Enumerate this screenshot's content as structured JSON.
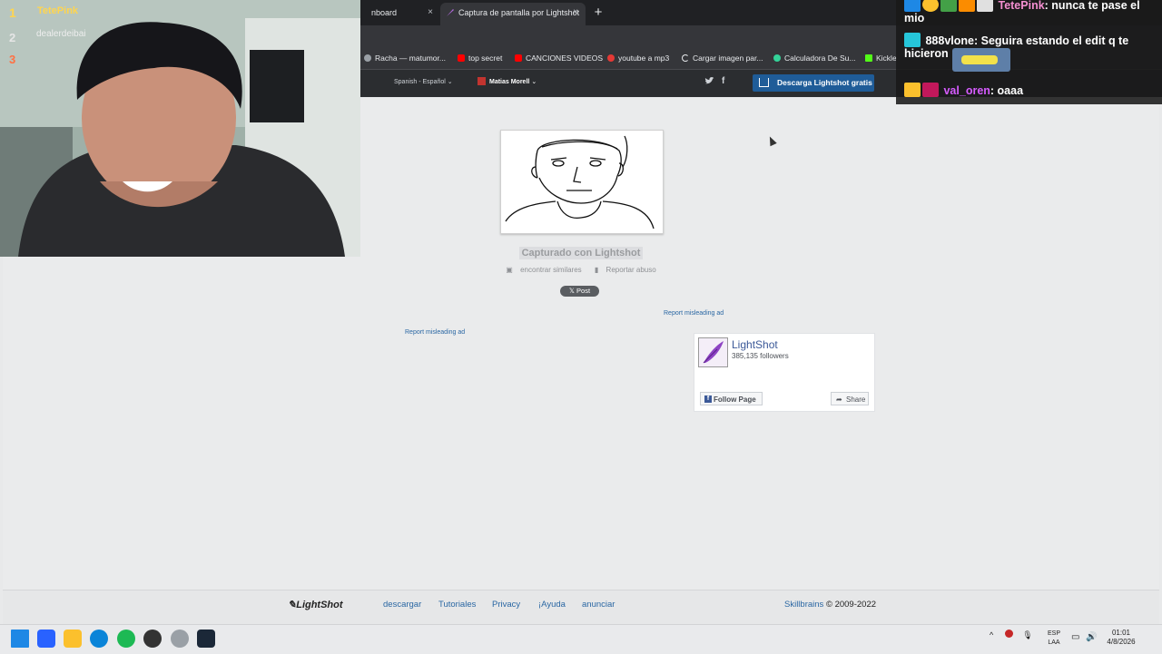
{
  "browser": {
    "tabs": [
      {
        "label": "nboard",
        "active": false
      },
      {
        "label": "Captura de pantalla por Lightshot",
        "active": true
      }
    ],
    "close_glyph": "×",
    "new_tab_glyph": "+",
    "bookmarks": [
      {
        "label": "Racha — matumor...",
        "icon": "globe-icon",
        "color": "#9aa0a6"
      },
      {
        "label": "top secret",
        "icon": "youtube-icon",
        "color": "#ff0000"
      },
      {
        "label": "CANCIONES VIDEOS",
        "icon": "youtube-icon",
        "color": "#ff0000"
      },
      {
        "label": "youtube a mp3",
        "icon": "youtube-icon",
        "color": "#e53935"
      },
      {
        "label": "Cargar imagen par...",
        "icon": "loader-icon",
        "color": "#e8eaed"
      },
      {
        "label": "Calculadora De Su...",
        "icon": "calculator-icon",
        "color": "#34d399"
      },
      {
        "label": "Kickle",
        "icon": "kick-icon",
        "color": "#53fc18"
      }
    ]
  },
  "lightshot": {
    "language": "Spanish - Español",
    "user": "Matias Morell",
    "twitter_glyph": "🐦",
    "facebook_glyph": "f",
    "download_button": "Descarga Lightshot gratis",
    "caption": "Capturado con Lightshot",
    "find_similar": "encontrar similares",
    "report_abuse": "Reportar abuso",
    "post_button": "𝕏 Post",
    "misleading_ad_1": "Report misleading ad",
    "misleading_ad_2": "Report misleading ad",
    "fb_page": {
      "name": "LightShot",
      "followers": "385,135 followers",
      "follow": "Follow Page",
      "share": "Share"
    }
  },
  "footer": {
    "logo": "LightShot",
    "links": [
      "descargar",
      "Tutoriales",
      "Privacy",
      "¡Ayuda",
      "anunciar"
    ],
    "company": "Skillbrains",
    "copyright": "© 2009-2022"
  },
  "leaderboard": [
    {
      "rank": "1",
      "name": "TetePink",
      "color": "#ffd54f"
    },
    {
      "rank": "2",
      "name": "dealerdeibai",
      "color": "#e6e6e6"
    },
    {
      "rank": "3",
      "name": "",
      "color": "#ff7043"
    }
  ],
  "chat": [
    {
      "user": "TetePink",
      "user_color": "#f48fd1",
      "message": ": nunca te pase el mio"
    },
    {
      "user": "888vlone",
      "user_color": "#ffffff",
      "message": ": Seguira estando el edit q te hicieron"
    },
    {
      "user": "val_oren",
      "user_color": "#d65cff",
      "message": ": oaaa"
    }
  ],
  "taskbar": {
    "language_top": "ESP",
    "language_bottom": "LAA",
    "time": "01:01",
    "date": "4/8/2026",
    "tray_arrow": "^"
  }
}
